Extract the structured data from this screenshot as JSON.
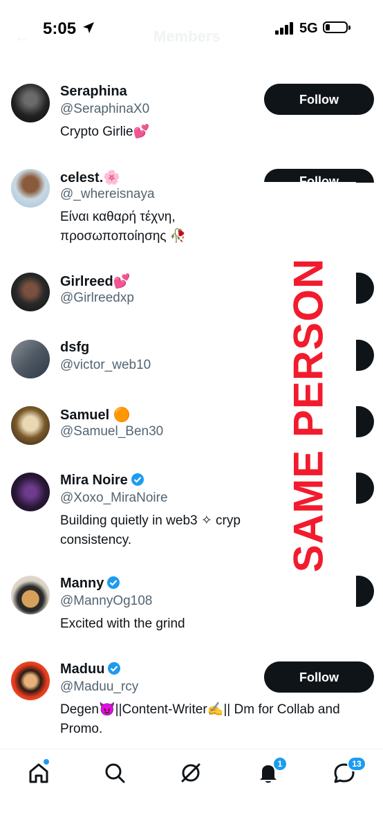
{
  "status_bar": {
    "time": "5:05",
    "network": "5G"
  },
  "header": {
    "title": "Members"
  },
  "members": [
    {
      "name": "Seraphina",
      "handle": "@SeraphinaX0",
      "bio": "Crypto Girlie💕",
      "follow_label": "Follow"
    },
    {
      "name": "celest.🌸",
      "handle": "@_whereisnaya",
      "bio": "Είναι καθαρή τέχνη, προσωποποίησης 🥀",
      "follow_label": "Follow"
    },
    {
      "name": "Girlreed💕",
      "handle": "@Girlreedxp",
      "bio": ""
    },
    {
      "name": "dsfg",
      "handle": "@victor_web10",
      "bio": ""
    },
    {
      "name": "Samuel 🟠",
      "handle": "@Samuel_Ben30",
      "bio": ""
    },
    {
      "name": "Mira Noire",
      "handle": "@Xoxo_MiraNoire",
      "bio": "Building quietly in web3 ✧ cryp consistency.",
      "verified": true
    },
    {
      "name": "Manny",
      "handle": "@MannyOg108",
      "bio": "Excited with the grind",
      "verified": true
    },
    {
      "name": "Maduu",
      "handle": "@Maduu_rcy",
      "bio": "Degen😈||Content-Writer✍️|| Dm for Collab and Promo.",
      "verified": true,
      "follow_label": "Follow"
    }
  ],
  "stamp_text": "SAME PERSON",
  "tabbar": {
    "notifications_badge": "1",
    "messages_badge": "13"
  },
  "colors": {
    "accent": "#1d9bf0",
    "stamp": "#f21b2d",
    "button": "#0f1419",
    "secondary_text": "#536471"
  }
}
